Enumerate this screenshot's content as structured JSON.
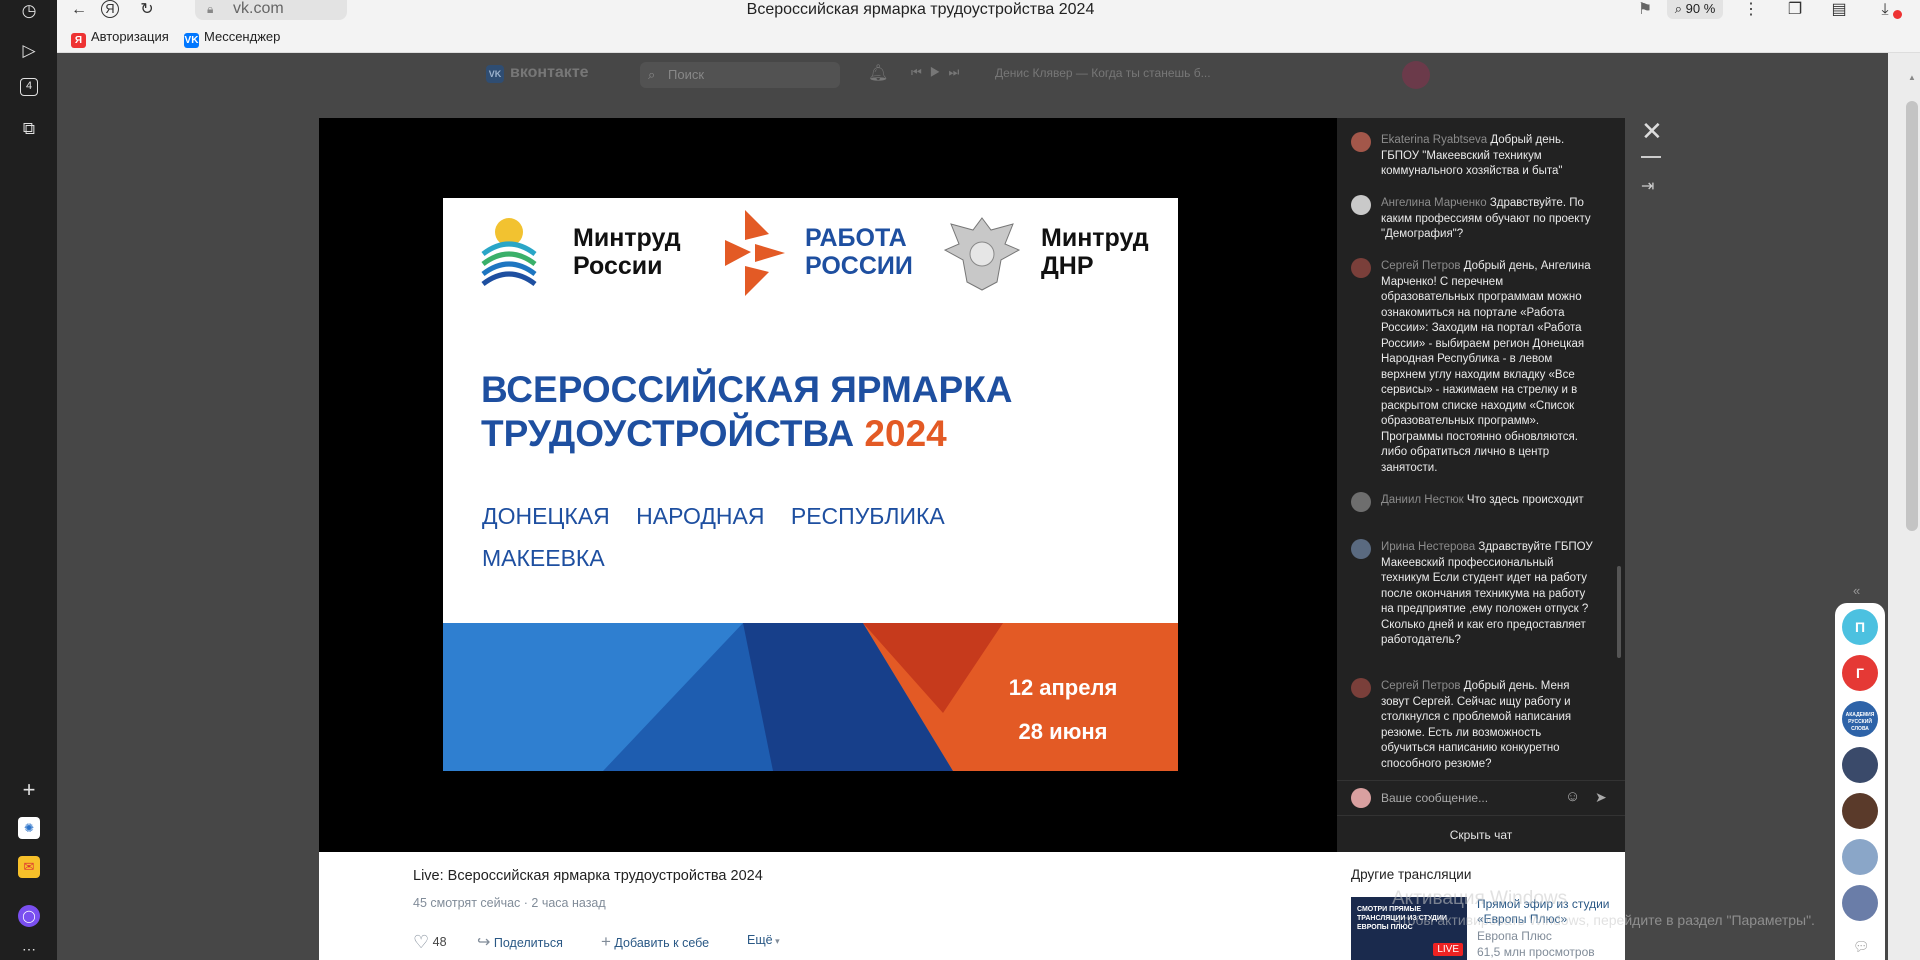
{
  "browser": {
    "url": "vk.com",
    "tab_title": "Всероссийская ярмарка трудоустройства 2024",
    "zoom": "90 %",
    "bookmarks": [
      "Авторизация",
      "Мессенджер"
    ],
    "sidebar_badge": "4"
  },
  "vk_header": {
    "logo": "вконтакте",
    "search_placeholder": "Поиск",
    "now_playing": "Денис Клявер — Когда ты станешь б..."
  },
  "poster": {
    "org1_line1": "Минтруд",
    "org1_line2": "России",
    "org2_line1": "РАБОТА",
    "org2_line2": "РОССИИ",
    "org3_line1": "Минтруд",
    "org3_line2": "ДНР",
    "headline_line1": "ВСЕРОССИЙСКАЯ ЯРМАРКА",
    "headline_line2": "ТРУДОУСТРОЙСТВА",
    "headline_year": "2024",
    "region_w1": "ДОНЕЦКАЯ",
    "region_w2": "НАРОДНАЯ",
    "region_w3": "РЕСПУБЛИКА",
    "city": "МАКЕЕВКА",
    "date1": "12 апреля",
    "date2": "28 июня"
  },
  "chat": {
    "messages": [
      {
        "author": "Ekaterina Ryabtseva",
        "text": "Добрый день. ГБПОУ \"Макеевский техникум коммунального хозяйства и быта\""
      },
      {
        "author": "Ангелина Марченко",
        "text": "Здравствуйте. По каким профессиям обучают по проекту \"Демография\"?"
      },
      {
        "author": "Сергей Петров",
        "text": "Добрый день, Ангелина Марченко! С перечнем образовательных программам можно ознакомиться на портале «Работа России»: Заходим на портал «Работа России» - выбираем регион Донецкая Народная Республика - в левом верхнем углу находим вкладку «Все сервисы» - нажимаем на стрелку и в раскрытом списке находим «Список образовательных программ». Программы постоянно обновляются. либо обратиться лично в центр занятости."
      },
      {
        "author": "Даниил Нестюк",
        "text": "Что здесь происходит"
      },
      {
        "author": "Ирина Нестерова",
        "text": "Здравствуйте ГБПОУ Макеевский профессиональный техникум Если студент идет на работу после окончания техникума на работу на предприятие ,ему положен отпуск ? Сколько дней и как его предоставляет работодатель?"
      },
      {
        "author": "Сергей Петров",
        "text": "Добрый день. Меня зовут Сергей. Сейчас ищу работу и столкнулся с проблемой написания резюме. Есть ли возможность обучиться написанию конкуретно способного резюме?"
      }
    ],
    "input_placeholder": "Ваше сообщение...",
    "hide_chat": "Скрыть чат"
  },
  "video_info": {
    "title": "Live: Всероссийская ярмарка трудоустройства 2024",
    "viewers": "45 смотрят сейчас",
    "time_ago": "2 часа назад",
    "likes": "48",
    "share": "Поделиться",
    "add": "Добавить к себе",
    "more": "Ещё"
  },
  "other_streams": {
    "heading": "Другие трансляции",
    "item_title": "Прямой эфир из студии «Европы Плюс»",
    "item_channel": "Европа Плюс",
    "item_views": "61,5 млн просмотров",
    "item_thumb_text": "СМОТРИ ПРЯМЫЕ ТРАНСЛЯЦИИ ИЗ СТУДИИ ЕВРОПЫ ПЛЮС",
    "live_badge": "LIVE"
  },
  "right_rail": {
    "avatar1": "П",
    "avatar2": "Г",
    "avatar3_text": "АКАДЕМИЯ РУССКИЙ СЛОВА"
  },
  "watermark": {
    "line1": "Активация Windows",
    "line2": "Чтобы активировать Windows, перейдите в раздел \"Параметры\"."
  },
  "colors": {
    "vk_blue": "#0077ff",
    "poster_blue": "#1e4fa0",
    "poster_orange": "#e35a25",
    "chat_bg": "#222222"
  }
}
